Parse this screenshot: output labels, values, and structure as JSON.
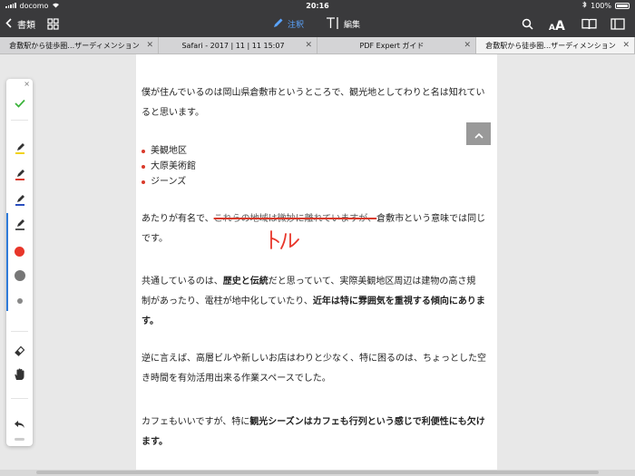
{
  "status_bar": {
    "carrier": "docomo",
    "time": "20:16",
    "battery": "100%"
  },
  "toolbar": {
    "back_label": "書類",
    "annotate_label": "注釈",
    "edit_label": "編集"
  },
  "tabs": [
    {
      "label": "倉敷駅から徒歩圏…ザーディメンション",
      "active": false
    },
    {
      "label": "Safari - 2017 | 11 | 11 15:07",
      "active": false
    },
    {
      "label": "PDF Expert ガイド",
      "active": false
    },
    {
      "label": "倉敷駅から徒歩圏…ザーディメンション",
      "active": true
    }
  ],
  "document": {
    "para1_line1": "僕が住んでいるのは岡山県倉敷市というところで、観光地としてわりと名は知れてい",
    "para1_line2": "ると思います。",
    "bullets": [
      "美観地区",
      "大原美術館",
      "ジーンズ"
    ],
    "para2_a": "あたりが有名で、",
    "para2_struck": "これらの地域は微妙に離れていますが、",
    "para2_b": "倉敷市という意味では同じ",
    "para2_line2": "です。",
    "handwriting_text": "トル",
    "para3_a": "共通しているのは、",
    "para3_bold1": "歴史と伝統",
    "para3_b": "だと思っていて、実際美観地区周辺は建物の高さ規",
    "para3_line2_a": "制があったり、電柱が地中化していたり、",
    "para3_bold2": "近年は特に雰囲気を重視する傾向にありま",
    "para3_bold3": "す。",
    "para4_line1": "逆に言えば、高層ビルや新しいお店はわりと少なく、特に困るのは、ちょっとした空",
    "para4_line2": "き時間を有効活用出来る作業スペースでした。",
    "para5_a": "カフェもいいですが、特に",
    "para5_bold1": "観光シーズンはカフェも行列という感じで利便性にも欠け",
    "para5_bold2": "ます。"
  },
  "palette": {
    "close_glyph": "×",
    "confirm_glyph": "✓",
    "pen_colors": [
      "#f2d31b",
      "#d93a2b",
      "#2a4fbf",
      "#555555"
    ],
    "dot_color": "#e8362a",
    "dot_gray": "#777777"
  },
  "colors": {
    "chrome": "#3a3a3c",
    "accent": "#5aa4ff",
    "annotation_red": "#d93a2b"
  }
}
